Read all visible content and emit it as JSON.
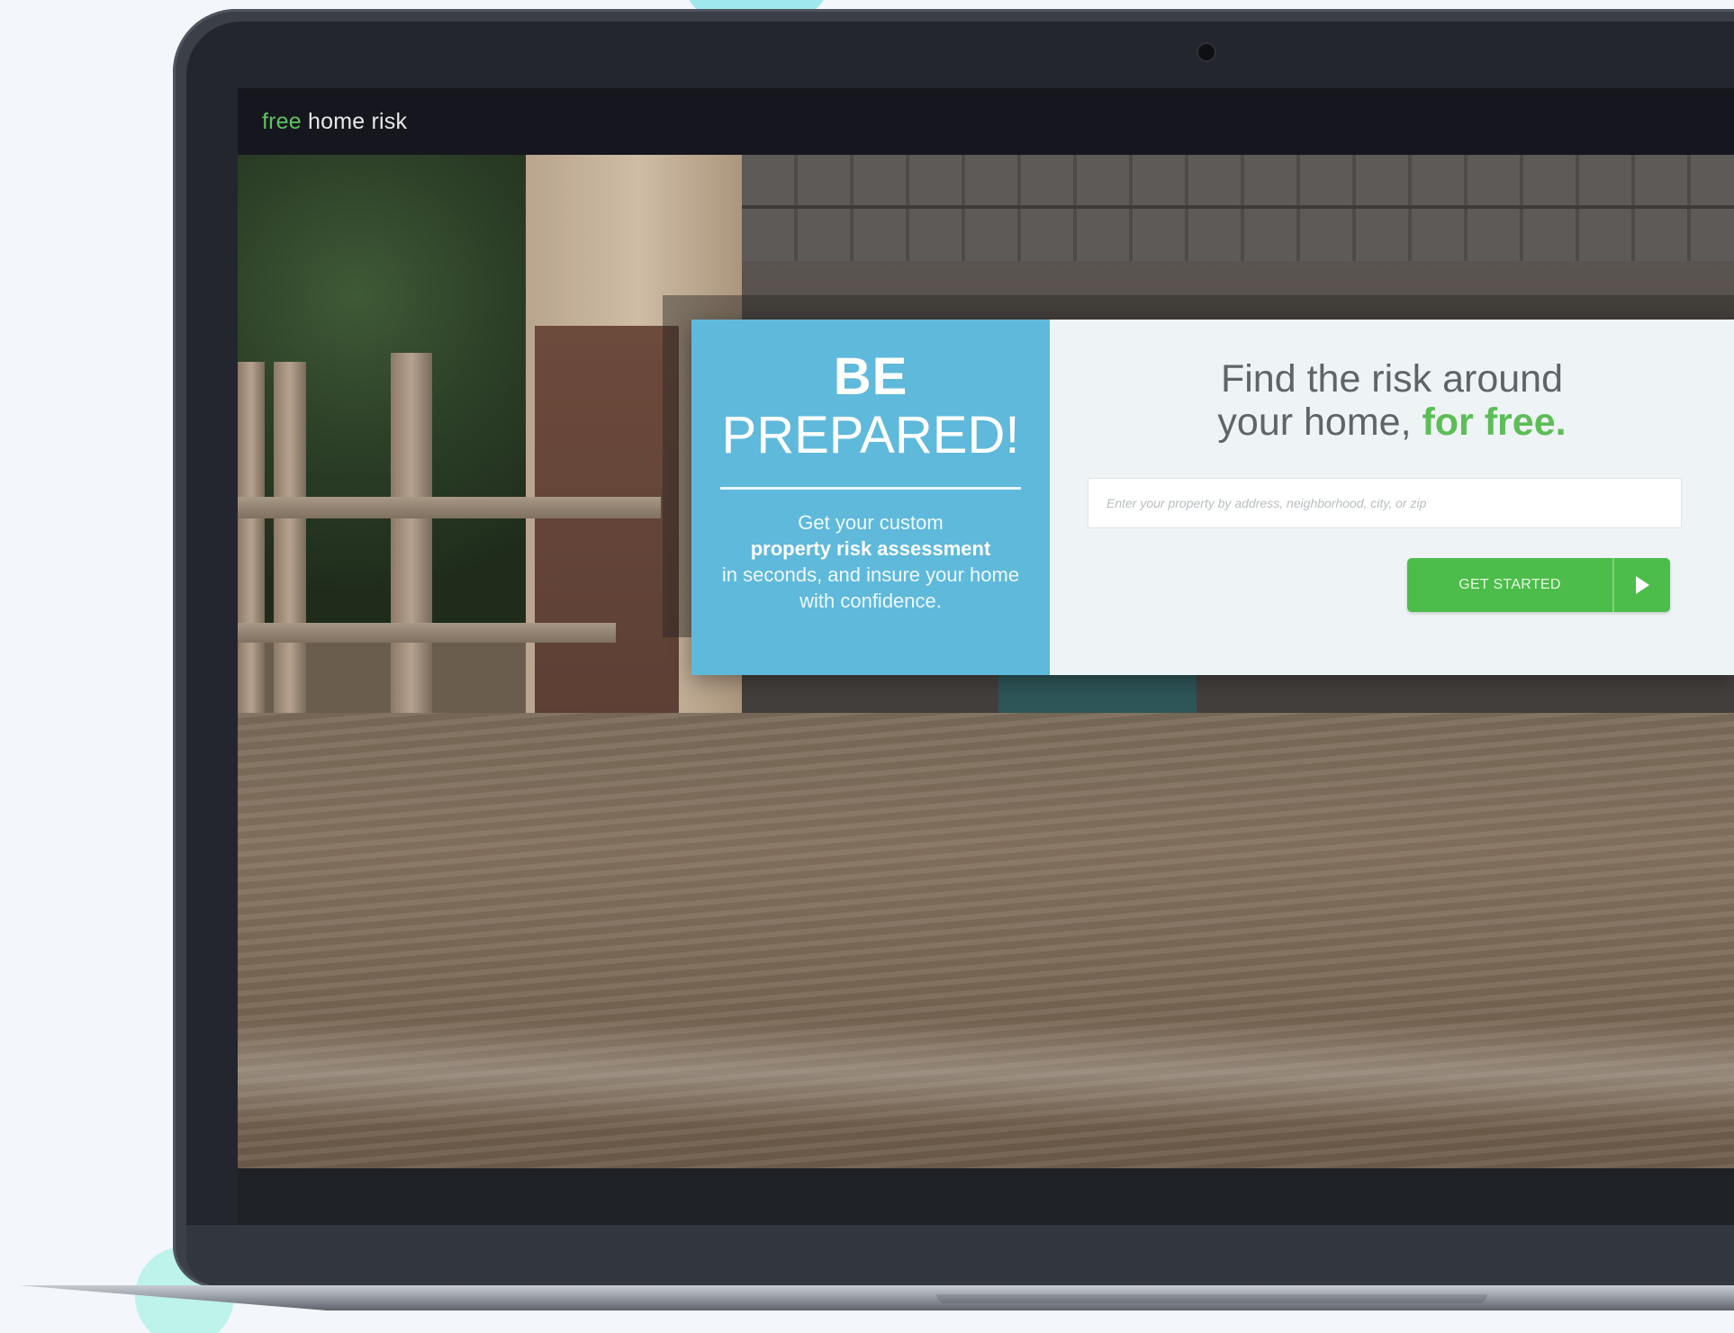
{
  "site": {
    "logo_accent": "free",
    "logo_rest": " home risk"
  },
  "hero": {
    "title_line1": "BE",
    "title_line2": "PREPARED!",
    "desc_line1": "Get your custom",
    "desc_bold": "property risk assessment",
    "desc_line2": "in seconds, and insure your home with confidence."
  },
  "search": {
    "headline_line1": "Find the risk around",
    "headline_line2": "your home, ",
    "headline_accent": "for free.",
    "placeholder": "Enter your property by address, neighborhood, city, or zip",
    "cta_label": "GET STARTED"
  },
  "colors": {
    "brand_green": "#4cbd4a",
    "panel_blue": "#5fb9db",
    "navbar_bg": "#16171e"
  },
  "icons": {
    "cta_icon": "play-arrow-icon",
    "camera": "camera-icon"
  }
}
